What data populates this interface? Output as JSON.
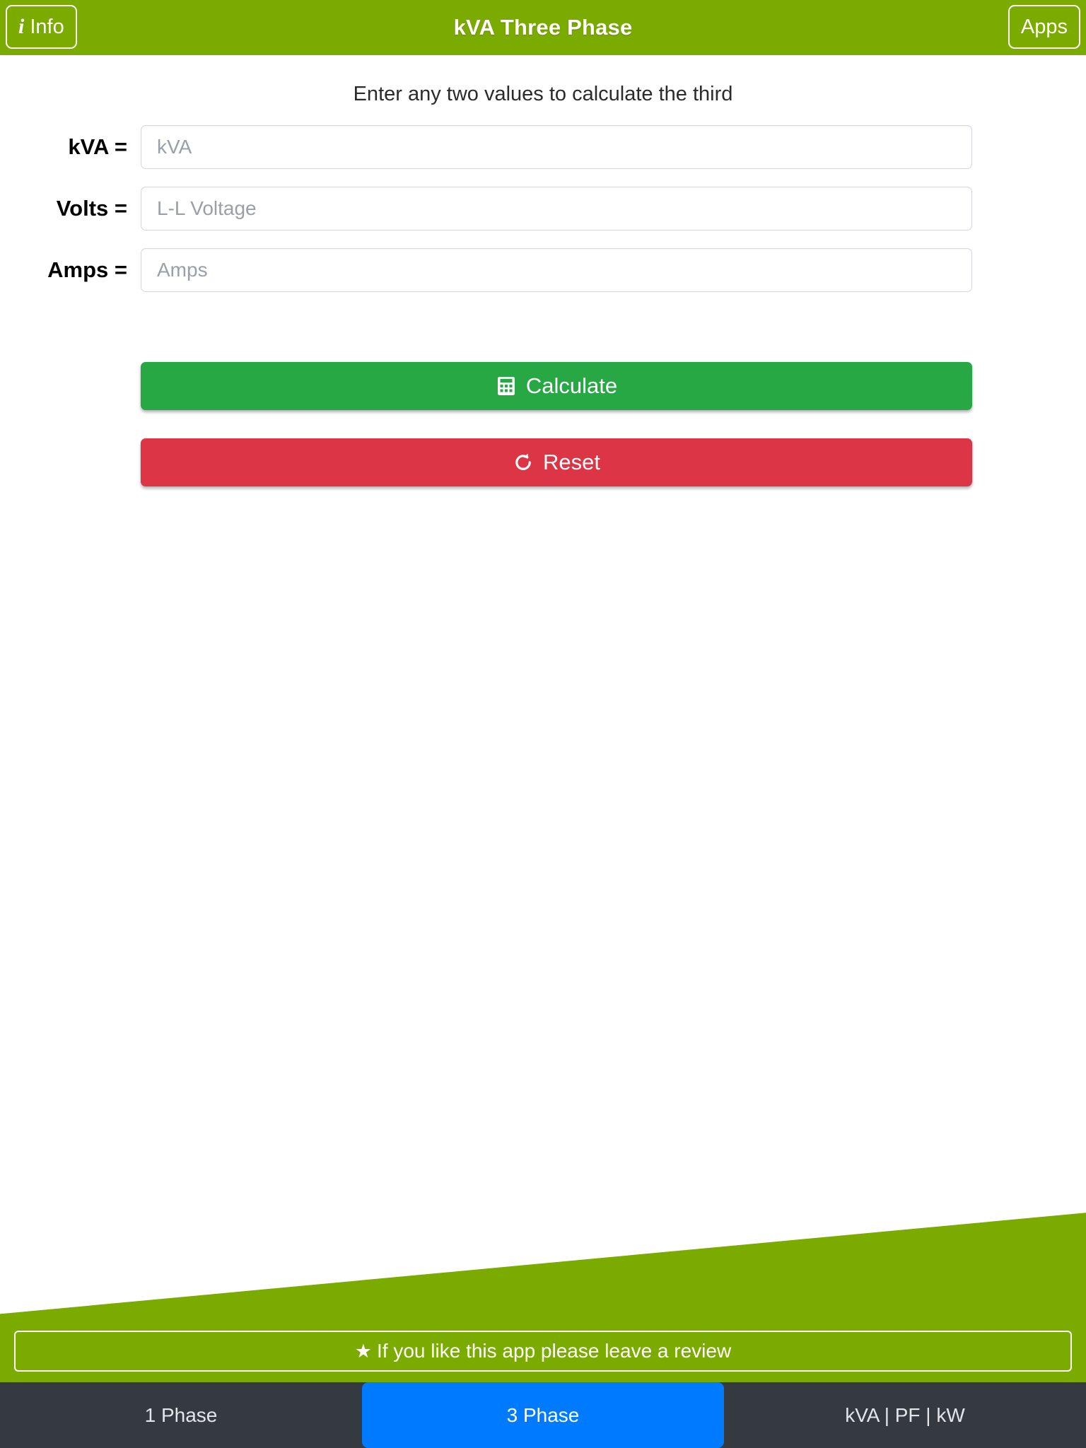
{
  "header": {
    "title": "kVA Three Phase",
    "info_label": "Info",
    "info_icon": "info-italic-i-icon",
    "apps_label": "Apps",
    "accent_green": "#7CAB00"
  },
  "main": {
    "subtitle": "Enter any two values to calculate the third",
    "fields": [
      {
        "label": "kVA =",
        "placeholder": "kVA",
        "value": ""
      },
      {
        "label": "Volts =",
        "placeholder": "L-L Voltage",
        "value": ""
      },
      {
        "label": "Amps =",
        "placeholder": "Amps",
        "value": ""
      }
    ],
    "calculate_label": "Calculate",
    "calculate_icon": "calculator-icon",
    "calculate_color": "#28a745",
    "reset_label": "Reset",
    "reset_icon": "refresh-circular-arrow-icon",
    "reset_color": "#dc3545"
  },
  "review": {
    "text": "If you like this app please leave a review",
    "icon": "star-icon",
    "star": "★"
  },
  "tabbar": {
    "background": "#343a40",
    "active_color": "#007bff",
    "tabs": [
      {
        "label": "1 Phase",
        "active": false
      },
      {
        "label": "3 Phase",
        "active": true
      },
      {
        "label": "kVA | PF | kW",
        "active": false
      }
    ]
  }
}
